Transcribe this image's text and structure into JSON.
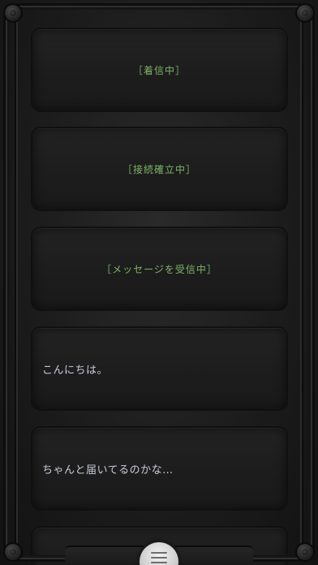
{
  "status_messages": [
    {
      "text": "［着信中］"
    },
    {
      "text": "［接続確立中］"
    },
    {
      "text": "［メッセージを受信中］"
    }
  ],
  "chat_messages": [
    {
      "text": "こんにちは。"
    },
    {
      "text": "ちゃんと届いてるのかな…"
    }
  ],
  "menu_button": {
    "icon": "menu-icon"
  },
  "colors": {
    "status_text": "#7fb36a",
    "chat_text": "#c9ccd8",
    "background": "#1c1c1c"
  }
}
